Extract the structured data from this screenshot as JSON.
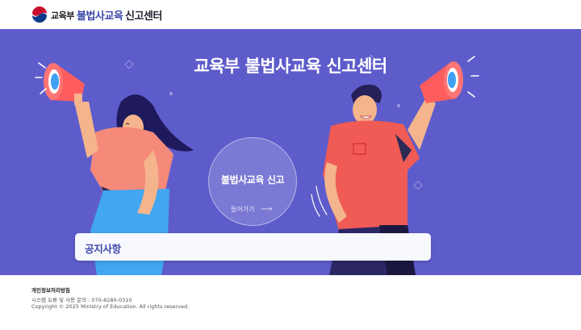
{
  "header": {
    "org_name": "교육부",
    "site_title_main": "불법사교육",
    "site_title_sub": "신고센터"
  },
  "hero": {
    "title": "교육부 불법사교육 신고센터",
    "report_button_label": "불법사교육 신고",
    "enter_label": "들어가기",
    "arrow": "⟶"
  },
  "notice": {
    "label": "공지사항"
  },
  "footer": {
    "privacy_policy": "개인정보처리방침",
    "contact": "시스템 오류 및 사용 문의 : 070-8280-0310",
    "copyright": "Copyright © 2025 Ministry of Education. All rights reserved."
  },
  "colors": {
    "hero_bg": "#5e5ccb",
    "brand_blue": "#3b47a8"
  },
  "icons": [
    "government-emblem-icon",
    "megaphone-icon",
    "arrow-right-icon"
  ]
}
